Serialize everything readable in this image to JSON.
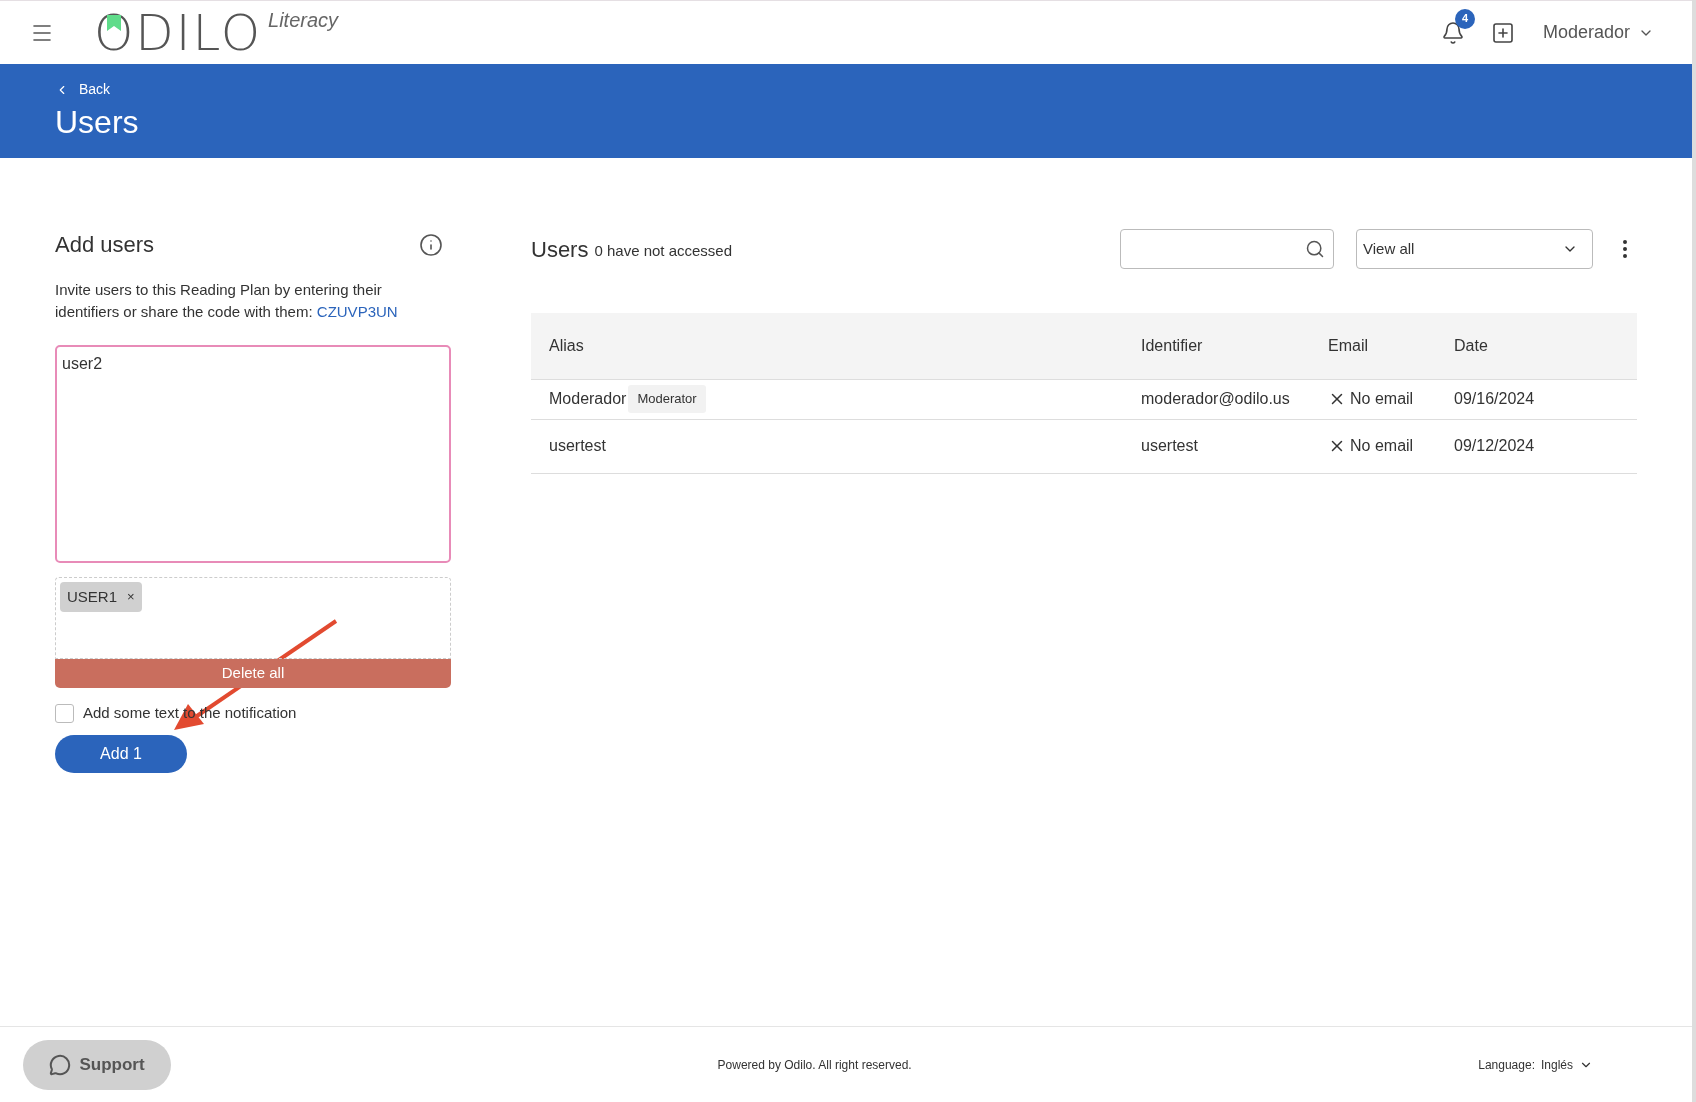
{
  "header": {
    "logo": "ODILO",
    "logo_sub": "Literacy",
    "notifications": "4",
    "user": "Moderador"
  },
  "banner": {
    "back": "Back",
    "title": "Users"
  },
  "add_users": {
    "title": "Add users",
    "description": "Invite users to this Reading Plan by entering their identifiers or share the code with them: ",
    "code": "CZUVP3UN",
    "textarea_value": "user2",
    "tags": [
      {
        "label": "USER1",
        "remove": "×"
      }
    ],
    "delete_all": "Delete all",
    "notify": {
      "label": "Add some text to the notification",
      "checked": false
    },
    "add_button": "Add 1"
  },
  "users": {
    "title": "Users",
    "subtitle": "0 have not accessed",
    "filter": "View all",
    "table": {
      "columns": [
        "Alias",
        "Identifier",
        "Email",
        "Date"
      ],
      "rows": [
        {
          "alias": "Moderador",
          "role": "Moderator",
          "identifier": "moderador@odilo.us",
          "email": "No email",
          "date": "09/16/2024"
        },
        {
          "alias": "usertest",
          "identifier": "usertest",
          "email": "No email",
          "date": "09/12/2024"
        }
      ]
    }
  },
  "footer": {
    "support": "Support",
    "copyright": "Powered by Odilo. All right reserved.",
    "language_label": "Language:",
    "language": "Inglés"
  }
}
